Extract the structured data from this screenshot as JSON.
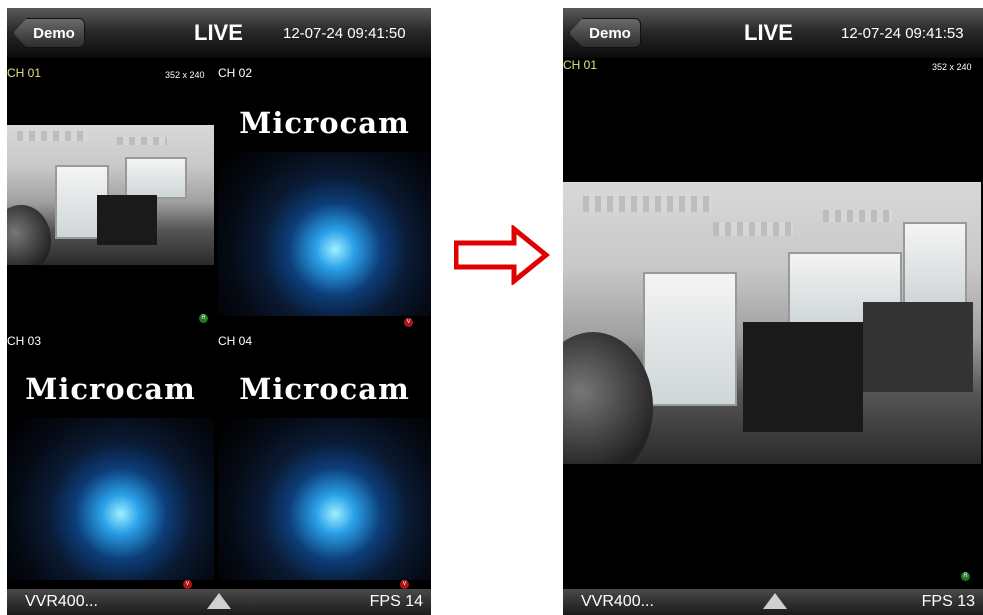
{
  "left_screen": {
    "back_label": "Demo",
    "title": "LIVE",
    "datetime": "12-07-24 09:41:50",
    "channels": [
      {
        "label": "CH 01",
        "resolution": "352 x 240",
        "badge": "R"
      },
      {
        "label": "CH 02",
        "resolution": "",
        "badge": "V",
        "logo": "Microcam"
      },
      {
        "label": "CH 03",
        "resolution": "",
        "badge": "V",
        "logo": "Microcam"
      },
      {
        "label": "CH 04",
        "resolution": "",
        "badge": "V",
        "logo": "Microcam"
      }
    ],
    "device_name": "VVR400...",
    "fps": "FPS 14"
  },
  "right_screen": {
    "back_label": "Demo",
    "title": "LIVE",
    "datetime": "12-07-24 09:41:53",
    "channel_label": "CH 01",
    "resolution": "352 x 240",
    "badge": "R",
    "device_name": "VVR400...",
    "fps": "FPS 13"
  },
  "colors": {
    "arrow_outline": "#e00000",
    "active_channel": "#e8e080",
    "badge_record": "#1f7a1f",
    "badge_video": "#b01414"
  },
  "icons": {
    "back": "back-chevron-icon",
    "toolbar_up": "triangle-up-icon",
    "transition": "right-arrow-icon"
  }
}
